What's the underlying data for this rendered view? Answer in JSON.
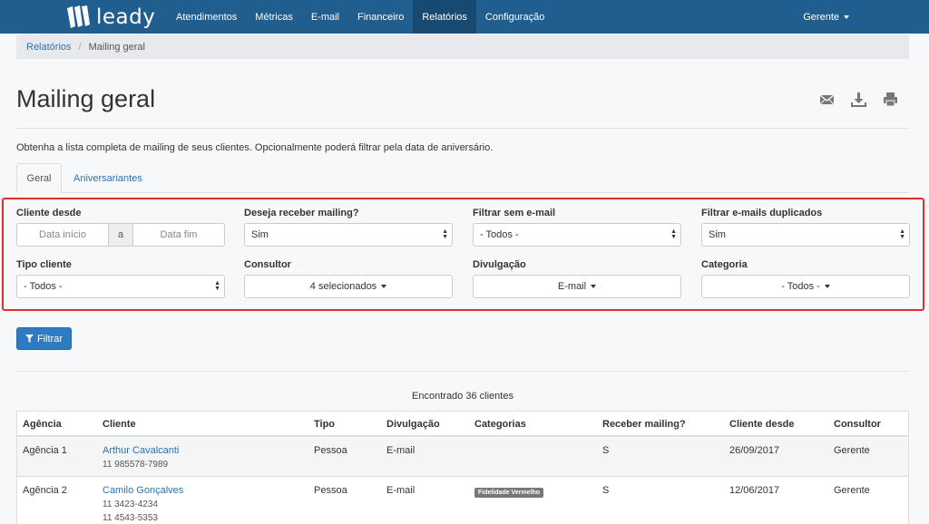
{
  "navbar": {
    "brand": "leady",
    "items": [
      "Atendimentos",
      "Métricas",
      "E-mail",
      "Financeiro",
      "Relatórios",
      "Configuração"
    ],
    "active_index": 4,
    "user": "Gerente"
  },
  "breadcrumb": {
    "parent": "Relatórios",
    "current": "Mailing geral"
  },
  "page": {
    "title": "Mailing geral",
    "description": "Obtenha a lista completa de mailing de seus clientes. Opcionalmente poderá filtrar pela data de aniversário.",
    "icons": [
      "email-icon",
      "download-icon",
      "print-icon"
    ]
  },
  "tabs": [
    "Geral",
    "Aniversariantes"
  ],
  "filters": {
    "cliente_desde": {
      "label": "Cliente desde",
      "start_placeholder": "Data início",
      "addon": "a",
      "end_placeholder": "Data fim"
    },
    "receber_mailing": {
      "label": "Deseja receber mailing?",
      "value": "Sim"
    },
    "sem_email": {
      "label": "Filtrar sem e-mail",
      "value": "- Todos -"
    },
    "emails_duplicados": {
      "label": "Filtrar e-mails duplicados",
      "value": "Sim"
    },
    "tipo_cliente": {
      "label": "Tipo cliente",
      "value": "- Todos -"
    },
    "consultor": {
      "label": "Consultor",
      "value": "4 selecionados"
    },
    "divulgacao": {
      "label": "Divulgação",
      "value": "E-mail"
    },
    "categoria": {
      "label": "Categoria",
      "value": "- Todos -"
    }
  },
  "filter_button": "Filtrar",
  "results": {
    "count_text": "Encontrado 36 clientes",
    "columns": [
      "Agência",
      "Cliente",
      "Tipo",
      "Divulgação",
      "Categorias",
      "Receber mailing?",
      "Cliente desde",
      "Consultor"
    ],
    "rows": [
      {
        "agencia": "Agência 1",
        "cliente": "Arthur Cavalcanti",
        "phones": [
          "11 985578-7989"
        ],
        "tipo": "Pessoa",
        "divulgacao": "E-mail",
        "categoria": "",
        "receber": "S",
        "desde": "26/09/2017",
        "consultor": "Gerente"
      },
      {
        "agencia": "Agência 2",
        "cliente": "Camilo Gonçalves",
        "phones": [
          "11 3423-4234",
          "11 4543-5353"
        ],
        "tipo": "Pessoa",
        "divulgacao": "E-mail",
        "categoria": "Fidelidade Vermelho",
        "receber": "S",
        "desde": "12/06/2017",
        "consultor": "Gerente"
      }
    ]
  },
  "colors": {
    "navbar": "#1f5e8f",
    "navbar_active": "#174a72",
    "link": "#2a73b4",
    "highlight_border": "#d9302c",
    "primary_button": "#2f7bc2"
  }
}
